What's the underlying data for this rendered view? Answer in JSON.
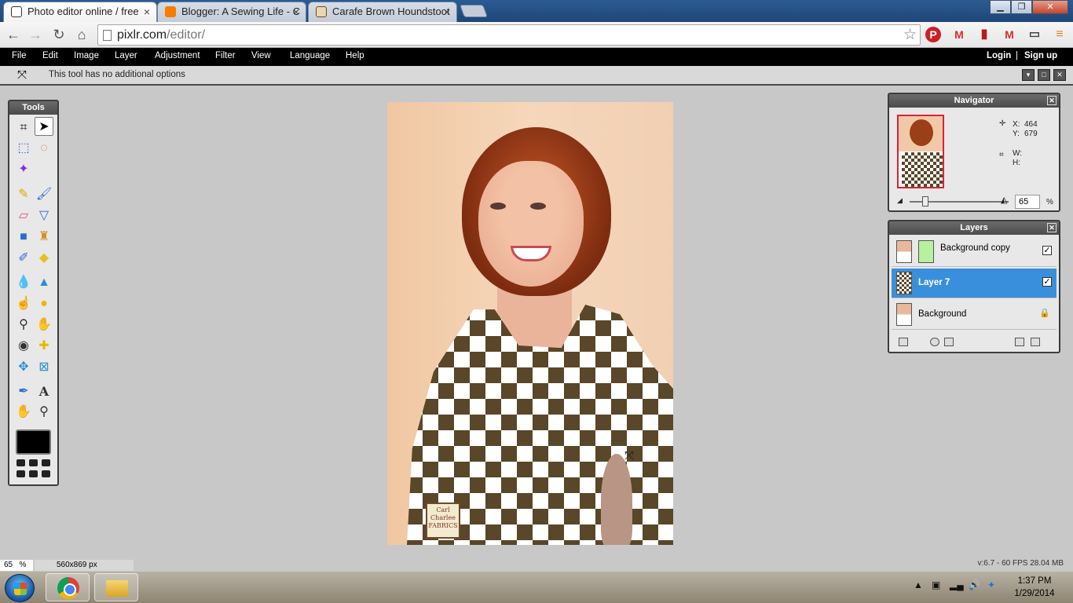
{
  "browser": {
    "tabs": [
      {
        "title": "Photo editor online / free",
        "active": true
      },
      {
        "title": "Blogger: A Sewing Life - C",
        "active": false
      },
      {
        "title": "Carafe Brown Houndstoot",
        "active": false
      }
    ],
    "address": {
      "domain": "pixlr.com",
      "path": "/editor/"
    },
    "window_buttons": {
      "minimize": "▁",
      "maximize": "❐",
      "close": "✕"
    }
  },
  "menu": {
    "items": [
      "File",
      "Edit",
      "Image",
      "Layer",
      "Adjustment",
      "Filter",
      "View",
      "Language",
      "Help"
    ],
    "login": "Login",
    "separator": "|",
    "signup": "Sign up"
  },
  "options_bar": {
    "message": "This tool has no additional options"
  },
  "tools_panel": {
    "title": "Tools",
    "icons": [
      "crop-icon",
      "move-icon",
      "marquee-icon",
      "lasso-icon",
      "wand-icon",
      "pencil-icon",
      "brush-icon",
      "eraser-icon",
      "paint-bucket-icon",
      "gradient-icon",
      "clone-stamp-icon",
      "color-replace-icon",
      "shape-icon",
      "blur-icon",
      "sharpen-icon",
      "smudge-icon",
      "sponge-icon",
      "burn-icon",
      "dodge-icon",
      "red-eye-icon",
      "spot-heal-icon",
      "bloat-icon",
      "pinch-icon",
      "eyedropper-icon",
      "type-icon",
      "hand-icon",
      "zoom-icon"
    ],
    "foreground_color": "#000000"
  },
  "canvas": {
    "logo_text": [
      "Carl",
      "Charlee",
      "FABRICS"
    ]
  },
  "navigator": {
    "title": "Navigator",
    "x_label": "X:",
    "x_value": "464",
    "y_label": "Y:",
    "y_value": "679",
    "w_label": "W:",
    "h_label": "H:",
    "zoom": "65",
    "zoom_unit": "%"
  },
  "layers": {
    "title": "Layers",
    "items": [
      {
        "name": "Background copy",
        "visible": true,
        "selected": false
      },
      {
        "name": "Layer 7",
        "visible": true,
        "selected": true
      },
      {
        "name": "Background",
        "locked": true,
        "selected": false
      }
    ]
  },
  "status": {
    "zoom": "65",
    "zoom_unit": "%",
    "image_size": "560x869 px",
    "fps_info": "v:6.7 - 60 FPS 28.04 MB"
  },
  "taskbar": {
    "time": "1:37 PM",
    "date": "1/29/2014"
  }
}
